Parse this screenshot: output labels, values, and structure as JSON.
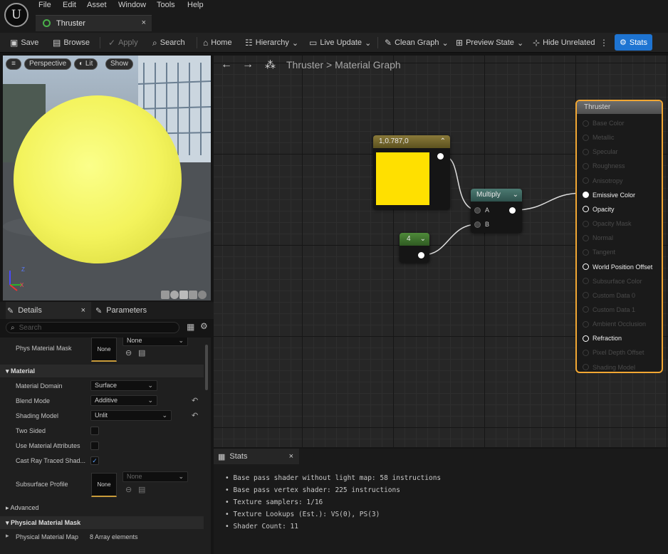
{
  "menu": [
    "File",
    "Edit",
    "Asset",
    "Window",
    "Tools",
    "Help"
  ],
  "tab": {
    "title": "Thruster",
    "close": "×"
  },
  "toolbar": {
    "save": "Save",
    "browse": "Browse",
    "apply": "Apply",
    "search": "Search",
    "home": "Home",
    "hierarchy": "Hierarchy",
    "live_update": "Live Update",
    "clean_graph": "Clean Graph",
    "preview_state": "Preview State",
    "hide_unrelated": "Hide Unrelated",
    "stats": "Stats"
  },
  "viewport": {
    "perspective": "Perspective",
    "lit": "Lit",
    "show": "Show",
    "axis_x": "X",
    "axis_z": "Z"
  },
  "details": {
    "tab_details": "Details",
    "tab_parameters": "Parameters",
    "close": "×",
    "search_placeholder": "Search",
    "phys_material_mask": {
      "label": "Phys Material Mask",
      "thumb": "None",
      "value": "None"
    },
    "section_material": "Material",
    "material_domain": {
      "label": "Material Domain",
      "value": "Surface"
    },
    "blend_mode": {
      "label": "Blend Mode",
      "value": "Additive"
    },
    "shading_model": {
      "label": "Shading Model",
      "value": "Unlit"
    },
    "two_sided": {
      "label": "Two Sided",
      "checked": false
    },
    "use_material_attributes": {
      "label": "Use Material Attributes",
      "checked": false
    },
    "cast_ray_traced": {
      "label": "Cast Ray Traced Shad...",
      "checked": true
    },
    "subsurface_profile": {
      "label": "Subsurface Profile",
      "thumb": "None",
      "value": "None"
    },
    "section_advanced": "Advanced",
    "section_physical_mask": "Physical Material Mask",
    "physical_material_map": {
      "label": "Physical Material Map",
      "value": "8 Array elements"
    }
  },
  "graph": {
    "breadcrumb_root": "Thruster",
    "breadcrumb_sep": ">",
    "breadcrumb_current": "Material Graph",
    "constant3": {
      "title": "1,0.787,0",
      "color": "#ffe000"
    },
    "constant": {
      "title": "4"
    },
    "multiply": {
      "title": "Multiply",
      "pin_a": "A",
      "pin_b": "B"
    },
    "result": {
      "title": "Thruster",
      "pins": [
        {
          "label": "Base Color",
          "active": false
        },
        {
          "label": "Metallic",
          "active": false
        },
        {
          "label": "Specular",
          "active": false
        },
        {
          "label": "Roughness",
          "active": false
        },
        {
          "label": "Anisotropy",
          "active": false
        },
        {
          "label": "Emissive Color",
          "active": true,
          "connected": true
        },
        {
          "label": "Opacity",
          "active": true,
          "connected": false
        },
        {
          "label": "Opacity Mask",
          "active": false
        },
        {
          "label": "Normal",
          "active": false
        },
        {
          "label": "Tangent",
          "active": false
        },
        {
          "label": "World Position Offset",
          "active": true,
          "connected": false
        },
        {
          "label": "Subsurface Color",
          "active": false
        },
        {
          "label": "Custom Data 0",
          "active": false
        },
        {
          "label": "Custom Data 1",
          "active": false
        },
        {
          "label": "Ambient Occlusion",
          "active": false
        },
        {
          "label": "Refraction",
          "active": true,
          "connected": false
        },
        {
          "label": "Pixel Depth Offset",
          "active": false
        },
        {
          "label": "Shading Model",
          "active": false
        }
      ]
    }
  },
  "stats": {
    "tab": "Stats",
    "close": "×",
    "lines": [
      "Base pass shader without light map: 58 instructions",
      "Base pass vertex shader: 225 instructions",
      "Texture samplers: 1/16",
      "Texture Lookups (Est.): VS(0), PS(3)",
      "Shader Count: 11"
    ]
  }
}
